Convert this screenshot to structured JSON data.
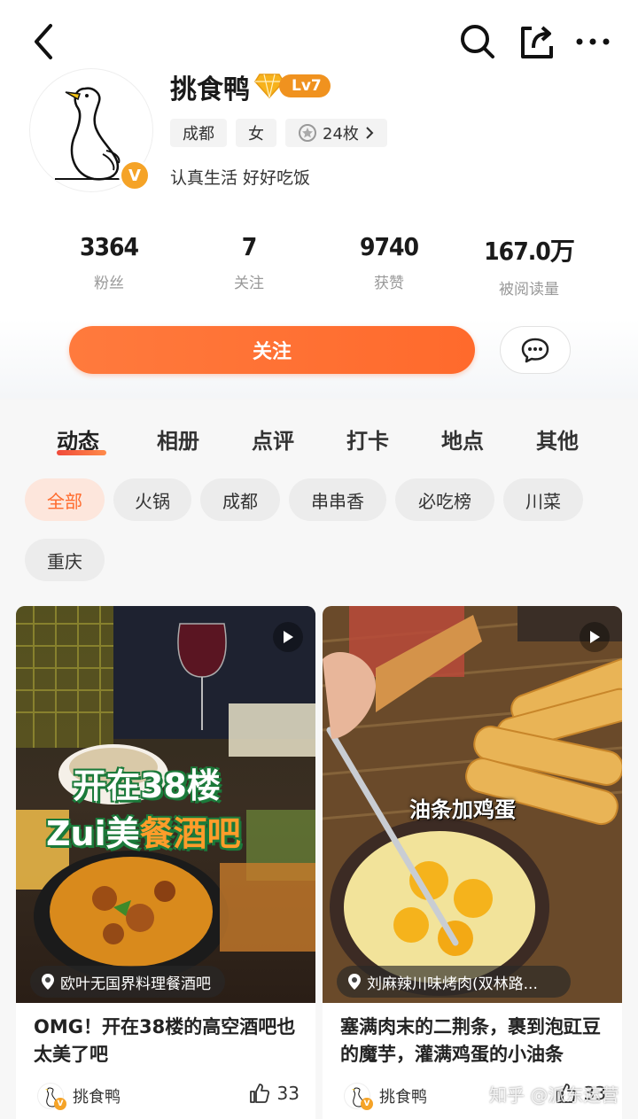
{
  "profile": {
    "name": "挑食鸭",
    "level": "Lv7",
    "tags": [
      "成都",
      "女"
    ],
    "medals": "24枚",
    "bio": "认真生活 好好吃饭",
    "avatar_badge": "V"
  },
  "stats": [
    {
      "value": "3364",
      "label": "粉丝"
    },
    {
      "value": "7",
      "label": "关注"
    },
    {
      "value": "9740",
      "label": "获赞"
    },
    {
      "value": "167.0万",
      "label": "被阅读量"
    }
  ],
  "actions": {
    "follow_label": "关注"
  },
  "tabs": [
    "动态",
    "相册",
    "点评",
    "打卡",
    "地点",
    "其他"
  ],
  "chips": [
    "全部",
    "火锅",
    "成都",
    "串串香",
    "必吃榜",
    "川菜",
    "重庆"
  ],
  "cards": [
    {
      "overlay_line1": "开在38楼",
      "overlay_line2a": "Zui美",
      "overlay_line2b": "餐酒吧",
      "location": "欧叶无国界料理餐酒吧",
      "title": "OMG！开在38楼的高空酒吧也太美了吧",
      "author": "挑食鸭",
      "likes": "33"
    },
    {
      "overlay_line1": "油条加鸡蛋",
      "location": "刘麻辣川味烤肉(双林路...",
      "title": "塞满肉末的二荆条，裹到泡豇豆的魔芋，灌满鸡蛋的小油条",
      "author": "挑食鸭",
      "likes": "33"
    }
  ],
  "watermark": "知乎 @派东运营",
  "colors": {
    "accent": "#ff6a2c",
    "level": "#f0921f",
    "badge": "#f5a327"
  }
}
